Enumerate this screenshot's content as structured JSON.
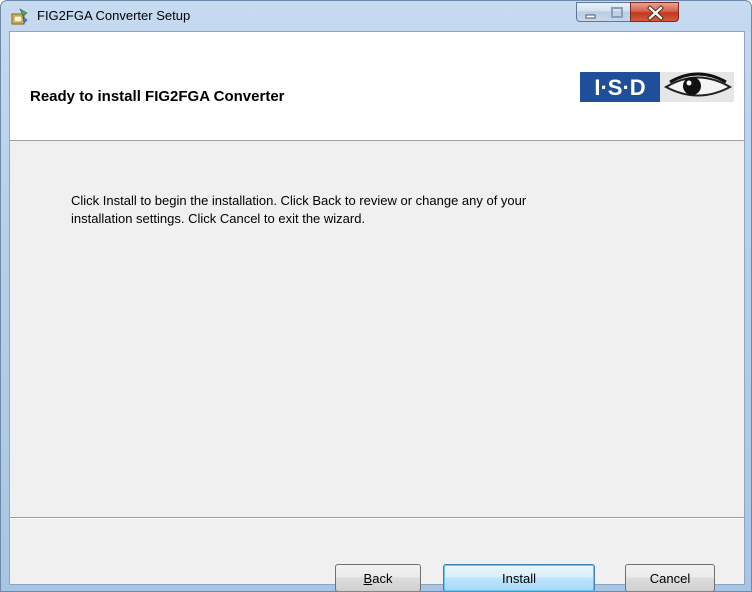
{
  "window": {
    "title": "FIG2FGA Converter Setup",
    "icon": "installer-icon"
  },
  "caption_buttons": {
    "minimize_icon": "minimize-icon",
    "maximize_icon": "maximize-icon",
    "close_icon": "close-icon"
  },
  "banner": {
    "title": "Ready to install FIG2FGA Converter",
    "logo_text": "I·S·D"
  },
  "body": {
    "line1": "Click Install to begin the installation. Click Back to review or change any of your",
    "line2": "installation settings. Click Cancel to exit the wizard."
  },
  "buttons": {
    "back": "Back",
    "install": "Install",
    "cancel": "Cancel"
  },
  "colors": {
    "titlebar": "#b9d1ea",
    "client_bg": "#f0f0f0",
    "logo_blue": "#1f4e9a",
    "close_red": "#c2391f"
  }
}
